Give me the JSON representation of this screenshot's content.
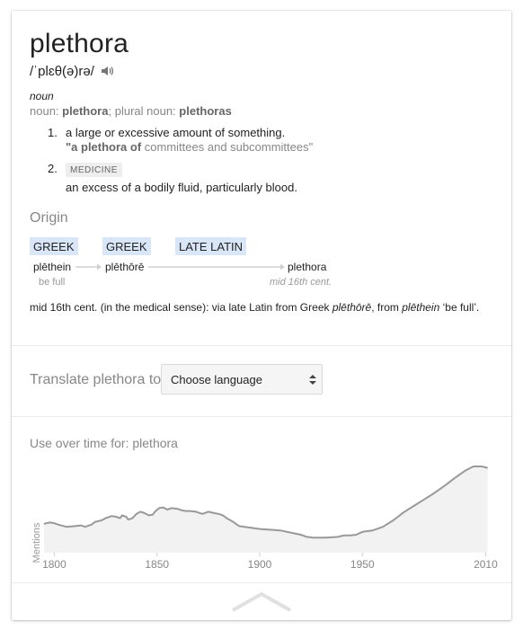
{
  "word": "plethora",
  "pronunciation": "/ˈplɛθ(ə)rə/",
  "speaker_icon": "speaker-icon",
  "part_of_speech": "noun",
  "forms": {
    "noun_label": "noun:",
    "noun": "plethora",
    "sep": ";",
    "plural_label": "plural noun:",
    "plural": "plethoras"
  },
  "senses": [
    {
      "number": "1.",
      "definition": "a large or excessive amount of something.",
      "example_bold": "\"a plethora of",
      "example_rest": "committees and subcommittees\""
    },
    {
      "number": "2.",
      "label": "MEDICINE",
      "definition": "an excess of a bodily fluid, particularly blood."
    }
  ],
  "origin": {
    "title": "Origin",
    "steps": [
      {
        "language": "GREEK",
        "word": "plēthein",
        "note": "be full"
      },
      {
        "language": "GREEK",
        "word": "plēthōrē",
        "note": ""
      },
      {
        "language": "LATE LATIN",
        "word": "",
        "note": ""
      },
      {
        "language": "",
        "word": "plethora",
        "note": "mid 16th cent."
      }
    ],
    "text_part1": "mid 16th cent. (in the medical sense): via late Latin from Greek",
    "text_word1": "plēthōrē",
    "text_part2": ", from",
    "text_word2": "plēthein",
    "text_part3": "‘be full’."
  },
  "translate": {
    "label": "Translate plethora to",
    "select_value": "Choose language"
  },
  "usage": {
    "title": "Use over time for: plethora",
    "collapse_icon": "chevron-up-icon"
  },
  "chart_data": {
    "type": "area",
    "title": "Use over time for: plethora",
    "xlabel": "",
    "ylabel": "Mentions",
    "xlim": [
      1795,
      2012
    ],
    "ylim": [
      0,
      100
    ],
    "x_ticks": [
      1800,
      1850,
      1900,
      1950,
      2010
    ],
    "grid": false,
    "legend": "none",
    "colors": {
      "line": "#999999",
      "fill": "#f2f2f2"
    },
    "series": [
      {
        "x": [
          1795,
          1796,
          1798,
          1800,
          1802,
          1806,
          1810,
          1813,
          1815,
          1818,
          1820,
          1823,
          1825,
          1828,
          1830,
          1832,
          1833,
          1835,
          1836,
          1838,
          1840,
          1842,
          1844,
          1846,
          1848,
          1849,
          1851,
          1853,
          1855,
          1857,
          1860,
          1862,
          1864,
          1866,
          1869,
          1872,
          1875,
          1878,
          1880,
          1882,
          1884,
          1887,
          1890,
          1895,
          1900,
          1905,
          1910,
          1915,
          1920,
          1923,
          1926,
          1928,
          1932,
          1938,
          1941,
          1944,
          1947,
          1950,
          1955,
          1960,
          1965,
          1970,
          1975,
          1980,
          1985,
          1990,
          1995,
          2000,
          2004,
          2008,
          2011
        ],
        "y": [
          40,
          41,
          42,
          41,
          39,
          36,
          37,
          38,
          36,
          39,
          43,
          45,
          48,
          51,
          50,
          48,
          52,
          50,
          46,
          48,
          54,
          57,
          55,
          52,
          53,
          57,
          62,
          63,
          60,
          62,
          61,
          59,
          58,
          58,
          57,
          54,
          57,
          55,
          54,
          52,
          48,
          43,
          37,
          35,
          33,
          32,
          31,
          28,
          25,
          22,
          21,
          21,
          21,
          22,
          24,
          24,
          25,
          29,
          31,
          36,
          45,
          56,
          65,
          74,
          83,
          93,
          104,
          114,
          120,
          120,
          118
        ]
      }
    ]
  }
}
